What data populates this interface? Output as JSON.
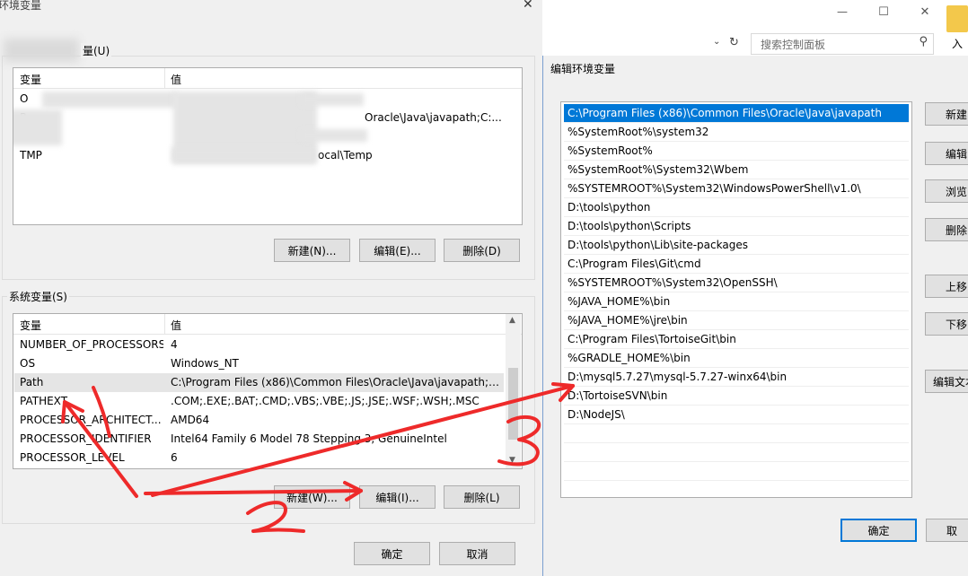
{
  "background_window": {
    "search_placeholder": "搜索控制面板",
    "minimize": "—",
    "maximize": "☐",
    "close": "✕",
    "side_label": "入"
  },
  "env_dialog": {
    "title": "环境变量",
    "close": "✕",
    "user_group_label": "量(U)",
    "user_table": {
      "headers": [
        "变量",
        "值"
      ],
      "rows": [
        {
          "name": "O",
          "value": ""
        },
        {
          "name": "P",
          "value": "Oracle\\Java\\javapath;C:..."
        },
        {
          "name": "",
          "value": ""
        },
        {
          "name": "TMP",
          "value": "ocal\\Temp"
        }
      ]
    },
    "user_buttons": {
      "new": "新建(N)...",
      "edit": "编辑(E)...",
      "delete": "删除(D)"
    },
    "system_group_label": "系统变量(S)",
    "system_table": {
      "headers": [
        "变量",
        "值"
      ],
      "rows": [
        {
          "name": "NUMBER_OF_PROCESSORS",
          "value": "4"
        },
        {
          "name": "OS",
          "value": "Windows_NT"
        },
        {
          "name": "Path",
          "value": "C:\\Program Files (x86)\\Common Files\\Oracle\\Java\\javapath;C:..."
        },
        {
          "name": "PATHEXT",
          "value": ".COM;.EXE;.BAT;.CMD;.VBS;.VBE;.JS;.JSE;.WSF;.WSH;.MSC"
        },
        {
          "name": "PROCESSOR_ARCHITECT...",
          "value": "AMD64"
        },
        {
          "name": "PROCESSOR_IDENTIFIER",
          "value": "Intel64 Family 6 Model 78 Stepping 3, GenuineIntel"
        },
        {
          "name": "PROCESSOR_LEVEL",
          "value": "6"
        }
      ]
    },
    "system_buttons": {
      "new": "新建(W)...",
      "edit": "编辑(I)...",
      "delete": "删除(L)"
    },
    "ok": "确定",
    "cancel": "取消"
  },
  "edit_dialog": {
    "title": "编辑环境变量",
    "paths": [
      "C:\\Program Files (x86)\\Common Files\\Oracle\\Java\\javapath",
      "%SystemRoot%\\system32",
      "%SystemRoot%",
      "%SystemRoot%\\System32\\Wbem",
      "%SYSTEMROOT%\\System32\\WindowsPowerShell\\v1.0\\",
      "D:\\tools\\python",
      "D:\\tools\\python\\Scripts",
      "D:\\tools\\python\\Lib\\site-packages",
      "C:\\Program Files\\Git\\cmd",
      "%SYSTEMROOT%\\System32\\OpenSSH\\",
      "%JAVA_HOME%\\bin",
      "%JAVA_HOME%\\jre\\bin",
      "C:\\Program Files\\TortoiseGit\\bin",
      "%GRADLE_HOME%\\bin",
      "D:\\mysql5.7.27\\mysql-5.7.27-winx64\\bin",
      "D:\\TortoiseSVN\\bin",
      "D:\\NodeJS\\"
    ],
    "selected_index": 0,
    "buttons": {
      "new": "新建(",
      "edit": "编辑",
      "browse": "浏览(",
      "delete": "删除",
      "move_up": "上移(",
      "move_down": "下移(",
      "edit_text": "编辑文本"
    },
    "ok": "确定",
    "cancel": "取"
  },
  "annotations": {
    "color": "#ee2a2a",
    "labels": [
      "1",
      "2",
      "3"
    ]
  }
}
